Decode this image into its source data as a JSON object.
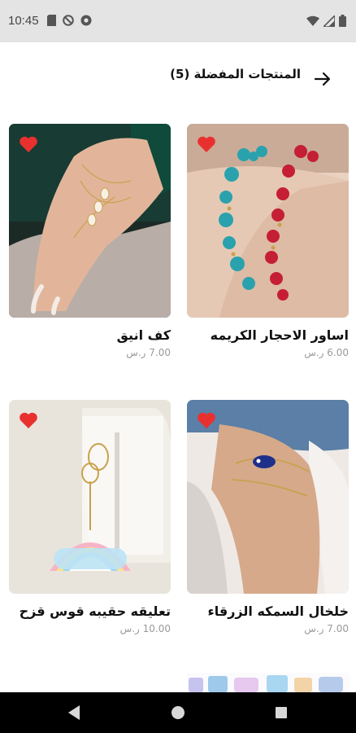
{
  "status_bar": {
    "time": "10:45",
    "icons_left": [
      "sd-card-icon",
      "no-disturb-icon",
      "chrome-icon"
    ],
    "icons_right": [
      "wifi-icon",
      "signal-icon",
      "battery-icon"
    ]
  },
  "header": {
    "title": "المنتجات المفضلة (5)",
    "back_icon": "arrow-right-icon"
  },
  "products": [
    {
      "name": "اساور الاحجار الكريمه",
      "price": "6.00 ر.س",
      "favorite": true,
      "image": "gemstone-bracelets"
    },
    {
      "name": "كف انيق",
      "price": "7.00 ر.س",
      "favorite": true,
      "image": "hand-chain"
    },
    {
      "name": "خلخال السمكه الزرقاء",
      "price": "7.00 ر.س",
      "favorite": true,
      "image": "fish-anklet"
    },
    {
      "name": "تعليقه حقيبه قوس قزح",
      "price": "10.00 ر.س",
      "favorite": true,
      "image": "rainbow-bag-charm"
    }
  ],
  "colors": {
    "heart": "#e8312f",
    "status_bar_bg": "#e4e4e4",
    "nav_bar_bg": "#000000",
    "price_text": "#9a9a9a"
  }
}
